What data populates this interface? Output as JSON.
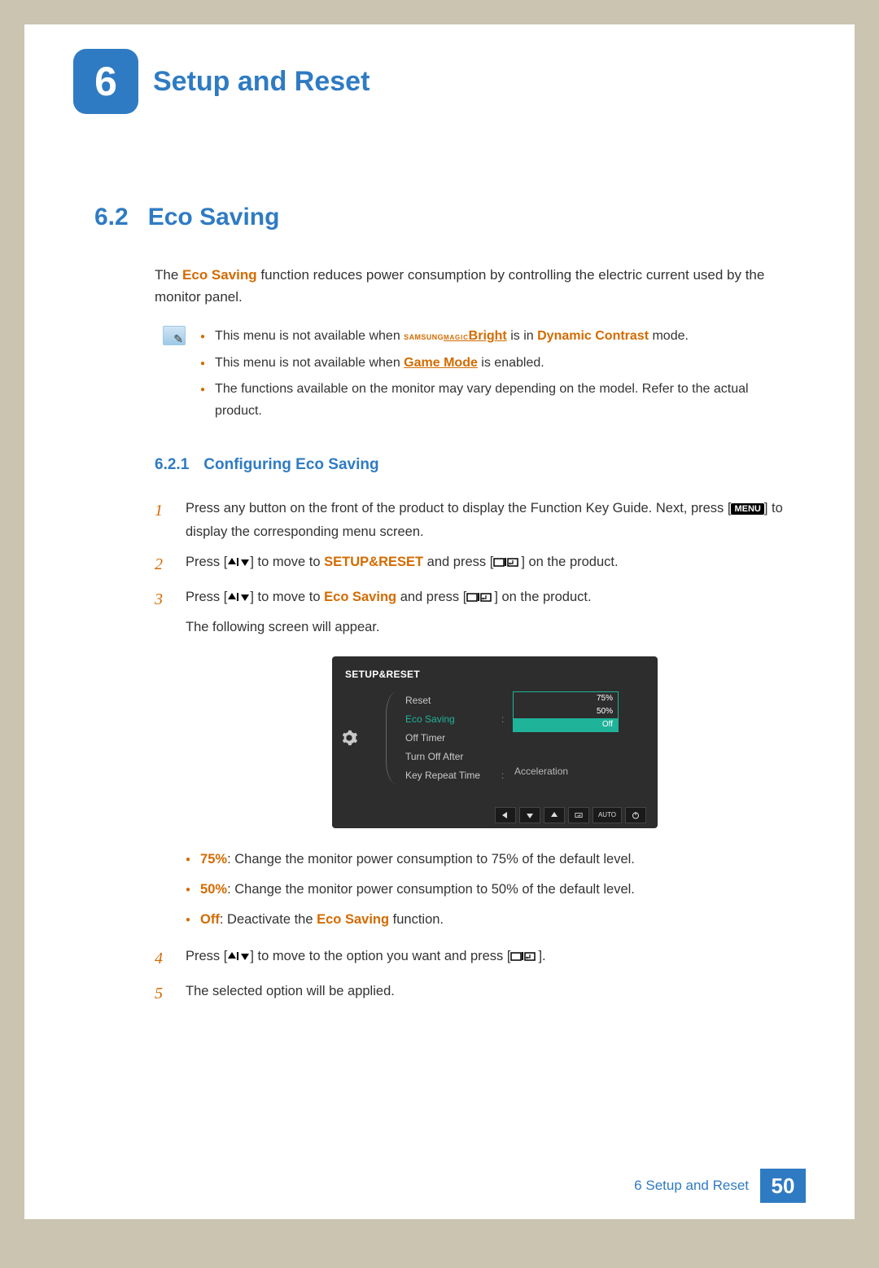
{
  "header": {
    "chapter_number": "6",
    "chapter_title": "Setup and Reset"
  },
  "section": {
    "number": "6.2",
    "title": "Eco Saving"
  },
  "intro": {
    "prefix": "The ",
    "feature": "Eco Saving",
    "suffix": " function reduces power consumption by controlling the electric current used by the monitor panel."
  },
  "notes": {
    "n1_pre": "This menu is not available when ",
    "n1_magic1": "SAMSUNG",
    "n1_magic2": "MAGIC",
    "n1_bright": "Bright",
    "n1_mid": " is in ",
    "n1_mode": "Dynamic Contrast",
    "n1_post": " mode.",
    "n2_pre": "This menu is not available when ",
    "n2_gm": "Game Mode",
    "n2_post": " is enabled.",
    "n3": "The functions available on the monitor may vary depending on the model. Refer to the actual product."
  },
  "subsection": {
    "number": "6.2.1",
    "title": "Configuring Eco Saving"
  },
  "steps": {
    "s1_num": "1",
    "s1_a": "Press any button on the front of the product to display the Function Key Guide. Next, press [",
    "s1_menu": "MENU",
    "s1_b": "] to display the corresponding menu screen.",
    "s2_num": "2",
    "s2_a": "Press [",
    "s2_b": "] to move to ",
    "s2_target": "SETUP&RESET",
    "s2_c": " and press [",
    "s2_d": "] on the product.",
    "s3_num": "3",
    "s3_a": "Press [",
    "s3_b": "] to move to ",
    "s3_target": "Eco Saving",
    "s3_c": " and press [",
    "s3_d": "] on the product.",
    "s3_follow": "The following screen will appear.",
    "opt1_label": "75%",
    "opt1_text": ": Change the monitor power consumption to 75% of the default level.",
    "opt2_label": "50%",
    "opt2_text": ": Change the monitor power consumption to 50% of the default level.",
    "opt3_label": "Off",
    "opt3_mid": ": Deactivate the ",
    "opt3_feature": "Eco Saving",
    "opt3_post": " function.",
    "s4_num": "4",
    "s4_a": "Press [",
    "s4_b": "] to move to the option you want and press [",
    "s4_c": "].",
    "s5_num": "5",
    "s5_text": "The selected option will be applied."
  },
  "osd": {
    "title": "SETUP&RESET",
    "menu": [
      "Reset",
      "Eco Saving",
      "Off Timer",
      "Turn Off After",
      "Key Repeat Time"
    ],
    "options": [
      "75%",
      "50%",
      "Off"
    ],
    "value_accel": "Acceleration",
    "nav_auto": "AUTO"
  },
  "footer": {
    "label": "6 Setup and Reset",
    "page": "50"
  }
}
